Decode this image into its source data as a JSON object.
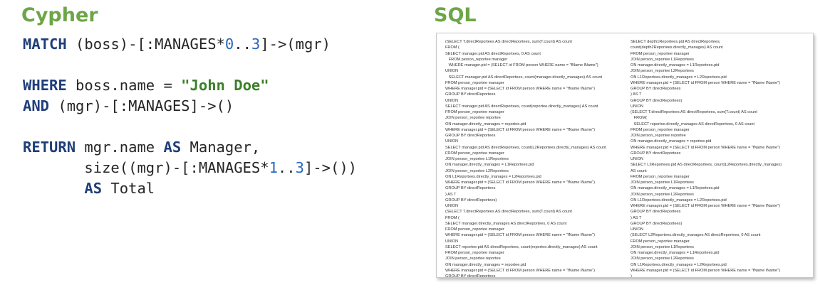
{
  "cypher": {
    "heading": "Cypher",
    "lines": [
      [
        {
          "t": "MATCH",
          "c": "kw"
        },
        {
          "t": " (boss)-[:MANAGES*",
          "c": ""
        },
        {
          "t": "0",
          "c": "num"
        },
        {
          "t": "..",
          "c": ""
        },
        {
          "t": "3",
          "c": "num"
        },
        {
          "t": "]->(mgr)",
          "c": ""
        }
      ],
      [],
      [
        {
          "t": "WHERE",
          "c": "kw"
        },
        {
          "t": " boss.name = ",
          "c": ""
        },
        {
          "t": "\"John Doe\"",
          "c": "str"
        }
      ],
      [
        {
          "t": "AND",
          "c": "kw"
        },
        {
          "t": " (mgr)-[:MANAGES]->()",
          "c": ""
        }
      ],
      [],
      [
        {
          "t": "RETURN",
          "c": "kw"
        },
        {
          "t": " mgr.name ",
          "c": ""
        },
        {
          "t": "AS",
          "c": "kw"
        },
        {
          "t": " Manager,",
          "c": ""
        }
      ],
      [
        {
          "t": "       size((mgr)-[:MANAGES*",
          "c": ""
        },
        {
          "t": "1",
          "c": "num"
        },
        {
          "t": "..",
          "c": ""
        },
        {
          "t": "3",
          "c": "num"
        },
        {
          "t": "]->())",
          "c": ""
        }
      ],
      [
        {
          "t": "       ",
          "c": ""
        },
        {
          "t": "AS",
          "c": "kw"
        },
        {
          "t": " Total",
          "c": ""
        }
      ]
    ]
  },
  "sql": {
    "heading": "SQL",
    "left_lines": [
      "(SELECT T.directReportees AS directReportees, sum(T.count) AS count",
      "FROM (",
      "SELECT manager.pid AS directReportees, 0 AS count",
      "   FROM person_reportee manager",
      "   WHERE manager.pid = (SELECT id FROM person WHERE name = \"fName lName\")",
      "UNION",
      "   SELECT manager.pid AS directReportees, count(manager.directly_manages) AS count",
      "FROM person_reportee manager",
      "WHERE manager.pid = (SELECT id FROM person WHERE name = \"fName lName\")",
      "GROUP BY directReportees",
      "UNION",
      "SELECT manager.pid AS directReportees, count(reportee.directly_manages) AS count",
      "FROM person_reportee manager",
      "JOIN person_reportee reportee",
      "ON manager.directly_manages = reportee.pid",
      "WHERE manager.pid = (SELECT id FROM person WHERE name = \"fName lName\")",
      "GROUP BY directReportees",
      "UNION",
      "SELECT manager.pid AS directReportees, count(L2Reportees.directly_manages) AS count",
      "FROM person_reportee manager",
      "JOIN person_reportee L1Reportees",
      "ON manager.directly_manages = L1Reportees.pid",
      "JOIN person_reportee L2Reportees",
      "ON L1Reportees.directly_manages = L2Reportees.pid",
      "WHERE manager.pid = (SELECT id FROM person WHERE name = \"fName lName\")",
      "GROUP BY directReportees",
      ") AS T",
      "GROUP BY directReportees)",
      "UNION",
      "(SELECT T.directReportees AS directReportees, sum(T.count) AS count",
      "FROM (",
      "SELECT manager.directly_manages AS directReportees, 0 AS count",
      "FROM person_reportee manager",
      "WHERE manager.pid = (SELECT id FROM person WHERE name = \"fName lName\")",
      "UNION",
      "SELECT reportee.pid AS directReportees, count(reportee.directly_manages) AS count",
      "FROM person_reportee manager",
      "JOIN person_reportee reportee",
      "ON manager.directly_manages = reportee.pid",
      "WHERE manager.pid = (SELECT id FROM person WHERE name = \"fName lName\")",
      "GROUP BY directReportees",
      "UNION"
    ],
    "right_lines": [
      "SELECT depth1Reportees.pid AS directReportees,",
      "count(depth2Reportees.directly_manages) AS count",
      "FROM person_reportee manager",
      "JOIN person_reportee L1Reportees",
      "ON manager.directly_manages = L1Reportees.pid",
      "JOIN person_reportee L2Reportees",
      "ON L1Reportees.directly_manages = L2Reportees.pid",
      "WHERE manager.pid = (SELECT id FROM person WHERE name = \"fName lName\")",
      "GROUP BY directReportees",
      ") AS T",
      "GROUP BY directReportees)",
      "UNION",
      "(SELECT T.directReportees AS directReportees, sum(T.count) AS count",
      "   FROM(",
      "   SELECT reportee.directly_manages AS directReportees, 0 AS count",
      "FROM person_reportee manager",
      "JOIN person_reportee reportee",
      "ON manager.directly_manages = reportee.pid",
      "WHERE manager.pid = (SELECT id FROM person WHERE name = \"fName lName\")",
      "GROUP BY directReportees",
      "UNION",
      "SELECT L2Reportees.pid AS directReportees, count(L2Reportees.directly_manages)",
      "AS count",
      "FROM person_reportee manager",
      "JOIN person_reportee L1Reportees",
      "ON manager.directly_manages = L1Reportees.pid",
      "JOIN person_reportee L2Reportees",
      "ON L1Reportees.directly_manages = L2Reportees.pid",
      "WHERE manager.pid = (SELECT id FROM person WHERE name = \"fName lName\")",
      "GROUP BY directReportees",
      ") AS T",
      "GROUP BY directReportees)",
      "UNION",
      "(SELECT L2Reportees.directly_manages AS directReportees, 0 AS count",
      "FROM person_reportee manager",
      "JOIN person_reportee L1Reportees",
      "ON manager.directly_manages = L1Reportees.pid",
      "JOIN person_reportee L2Reportees",
      "ON L1Reportees.directly_manages = L2Reportees.pid",
      "WHERE manager.pid = (SELECT id FROM person WHERE name = \"fName lName\")",
      ")"
    ]
  },
  "colors": {
    "heading": "#6da547",
    "keyword": "#1f3e7a",
    "number": "#2a66b8",
    "string": "#3b7f2a",
    "text": "#262626"
  }
}
